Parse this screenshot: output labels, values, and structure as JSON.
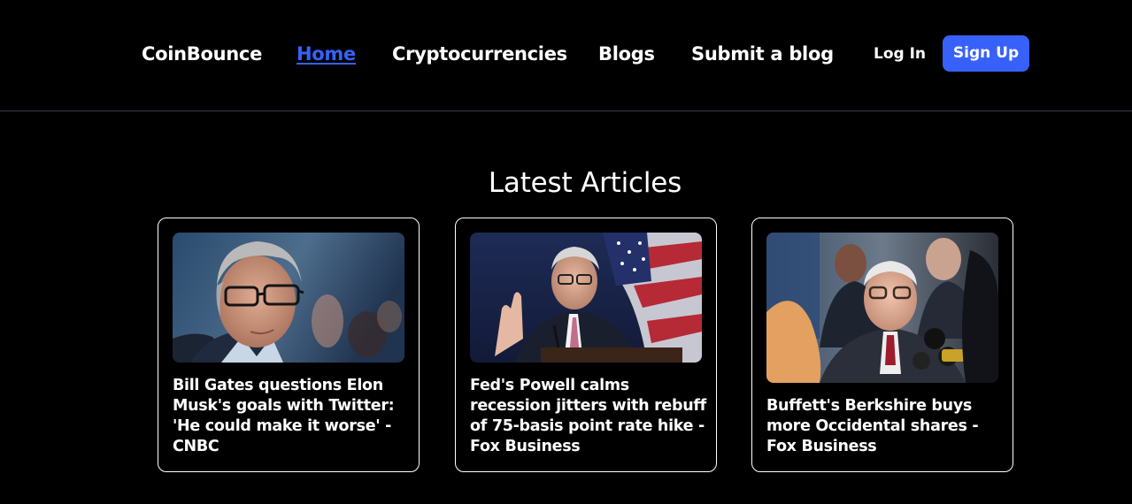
{
  "nav": {
    "brand": "CoinBounce",
    "links": [
      {
        "label": "Home",
        "active": true
      },
      {
        "label": "Cryptocurrencies",
        "active": false
      },
      {
        "label": "Blogs",
        "active": false
      },
      {
        "label": "Submit a blog",
        "active": false
      }
    ],
    "login_label": "Log In",
    "signup_label": "Sign Up"
  },
  "main": {
    "section_title": "Latest Articles",
    "articles": [
      {
        "title": "Bill Gates questions Elon Musk's goals with Twitter: 'He could make it worse' - CNBC"
      },
      {
        "title": "Fed's Powell calms recession jitters with rebuff of 75-basis point rate hike - Fox Business"
      },
      {
        "title": "Buffett's Berkshire buys more Occidental shares - Fox Business"
      }
    ]
  },
  "colors": {
    "background": "#000000",
    "accent": "#3861fb",
    "text": "#ffffff",
    "divider": "#3a3a44"
  }
}
